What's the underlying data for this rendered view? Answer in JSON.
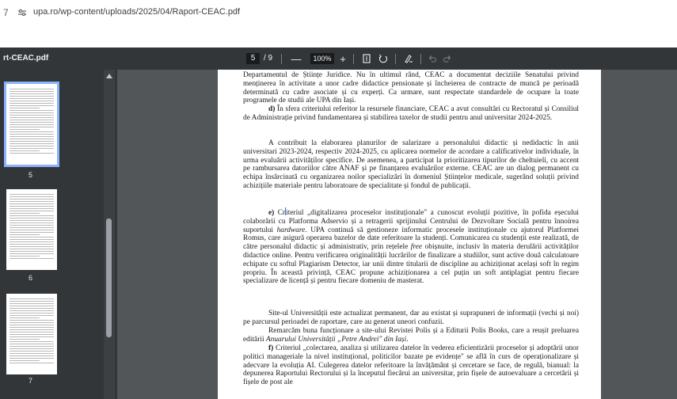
{
  "browser": {
    "back_glyph": "7",
    "url": "upa.ro/wp-content/uploads/2025/04/Raport-CEAC.pdf"
  },
  "toolbar": {
    "title": "rt-CEAC.pdf",
    "current_page": "5",
    "page_sep": "/ 9",
    "zoom_out": "—",
    "zoom": "100%",
    "zoom_in": "+"
  },
  "thumbnails": [
    {
      "label": "5",
      "selected": true
    },
    {
      "label": "6",
      "selected": false
    },
    {
      "label": "7",
      "selected": false
    }
  ],
  "document": {
    "p1": "Departamentul de Științe Juridice. Nu în ultimul rând, CEAC a documentat deciziile Senatului privind menținerea în activitate a unor cadre didactice pensionate și încheierea de contracte de muncă pe perioadă determinată cu cadre asociate și cu experți. Ca urmare, sunt respectate standardele de ocupare la toate programele de studii ale UPA din Iași.",
    "p2_lead": "d)",
    "p2": " În sfera criteriului referitor la resursele financiare, CEAC a avut consultări cu Rectoratul și Consiliul de Administrație privind fundamentarea și stabilirea taxelor de studii pentru anul universitar 2024-2025.",
    "p3": "A contribuit la elaborarea planurilor de salarizare a personalului didactic și nedidactic în anii universitari 2023-2024, respectiv 2024-2025, cu aplicarea normelor de acordare a calificativelor individuale, în urma evaluării activităților specifice. De asemenea, a participat la prioritizarea tipurilor de cheltuieli, cu accent pe rambursarea datoriilor către ANAF și pe finanțarea evaluărilor externe. CEAC are un dialog permanent cu echipa însărcinată cu organizarea noilor specializări în domeniul Științelor medicale, sugerând soluții privind achizițiile materiale pentru laboratoare de specialitate și fondul de publicații.",
    "p4_lead": "e)",
    "p4_a": " Cr",
    "p4_b": "iteriul „digitalizarea proceselor instituționale\" a cunoscut evoluții pozitive, în pofida eșecului colaborării cu Platforma Adservio și a retragerii sprijinului Centrului de Dezvoltare Socială pentru înnoirea suportului ",
    "p4_i1": "hardware",
    "p4_c": ". UPA continuă să gestioneze informatic procesele instituționale cu ajutorul Platformei Romus, care asigură operarea bazelor de date referitoare la studenți. Comunicarea cu studenții este realizată, de către personalul didactic și administrativ, prin rețelele ",
    "p4_i2": "free",
    "p4_d": " obișnuite, inclusiv în materia derulării activităților didactice online. Pentru verificarea originalității lucrărilor de finalizare a studiilor, sunt active două calculatoare echipate cu softul Plagiarism Detector, iar unii dintre titularii de discipline au achiziționat același soft în regim propriu. În această privință, CEAC propune achiziționarea a cel puțin un soft antiplagiat pentru fiecare specializare de licență și pentru fiecare domeniu de masterat.",
    "p5": "Site-ul Universității este actualizat permanent, dar au existat și suprapuneri de informații (vechi și noi) pe parcursul perioadei de raportare, care au generat uneori confuzii.",
    "p6_a": "Remarcăm buna funcționare a site-ului Revistei Polis și a Editurii Polis Books, care a reușit preluarea editării ",
    "p6_i": "Anuarului Universității „Petre Andrei\" din Iași",
    "p6_b": ".",
    "p7_lead": "f)",
    "p7": " Criteriul „colectarea, analiza și utilizarea datelor în vederea eficientizării proceselor și adoptării unor politici manageriale la nivel instituțional, politicilor bazate pe evidențe\" se află în curs de operaționalizare și adecvare la evoluția AI. Culegerea datelor referitoare la învățământ și cercetare se face, de regulă, bianual: la depunerea Raportului Rectorului și la începutul fiecărui an universitar, prin fișele de autoevaluare a cercetării și fișele de post ale"
  },
  "colors": {
    "toolbar_bg": "#323639",
    "viewer_bg": "#525659",
    "selected_thumb_outline": "#8ab4f8"
  },
  "icons": [
    "site-info-icon",
    "fit-page-icon",
    "rotate-icon",
    "annotate-icon",
    "undo-icon",
    "redo-icon",
    "scroll-up-icon"
  ]
}
